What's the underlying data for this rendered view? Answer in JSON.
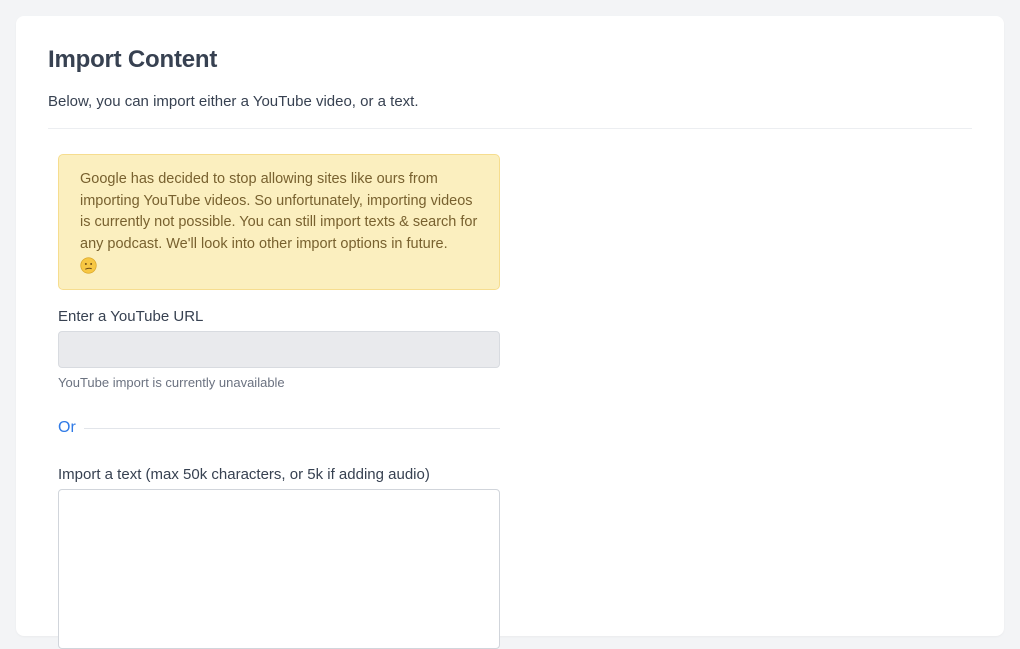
{
  "page": {
    "title": "Import Content",
    "subtitle": "Below, you can import either a YouTube video, or a text."
  },
  "notice": {
    "text": "Google has decided to stop allowing sites like ours from importing YouTube videos. So unfortunately, importing videos is currently not possible. You can still import texts & search for any podcast. We'll look into other import options in future.",
    "emoji_icon": "confused-face-icon",
    "background_color": "#fbefbf",
    "text_color": "#78612f"
  },
  "youtube": {
    "label": "Enter a YouTube URL",
    "value": "",
    "placeholder": "",
    "help_text": "YouTube import is currently unavailable",
    "disabled": true
  },
  "divider": {
    "label": "Or",
    "color": "#2f7ae6"
  },
  "text_import": {
    "label": "Import a text (max 50k characters, or 5k if adding audio)",
    "value": "",
    "placeholder": ""
  }
}
